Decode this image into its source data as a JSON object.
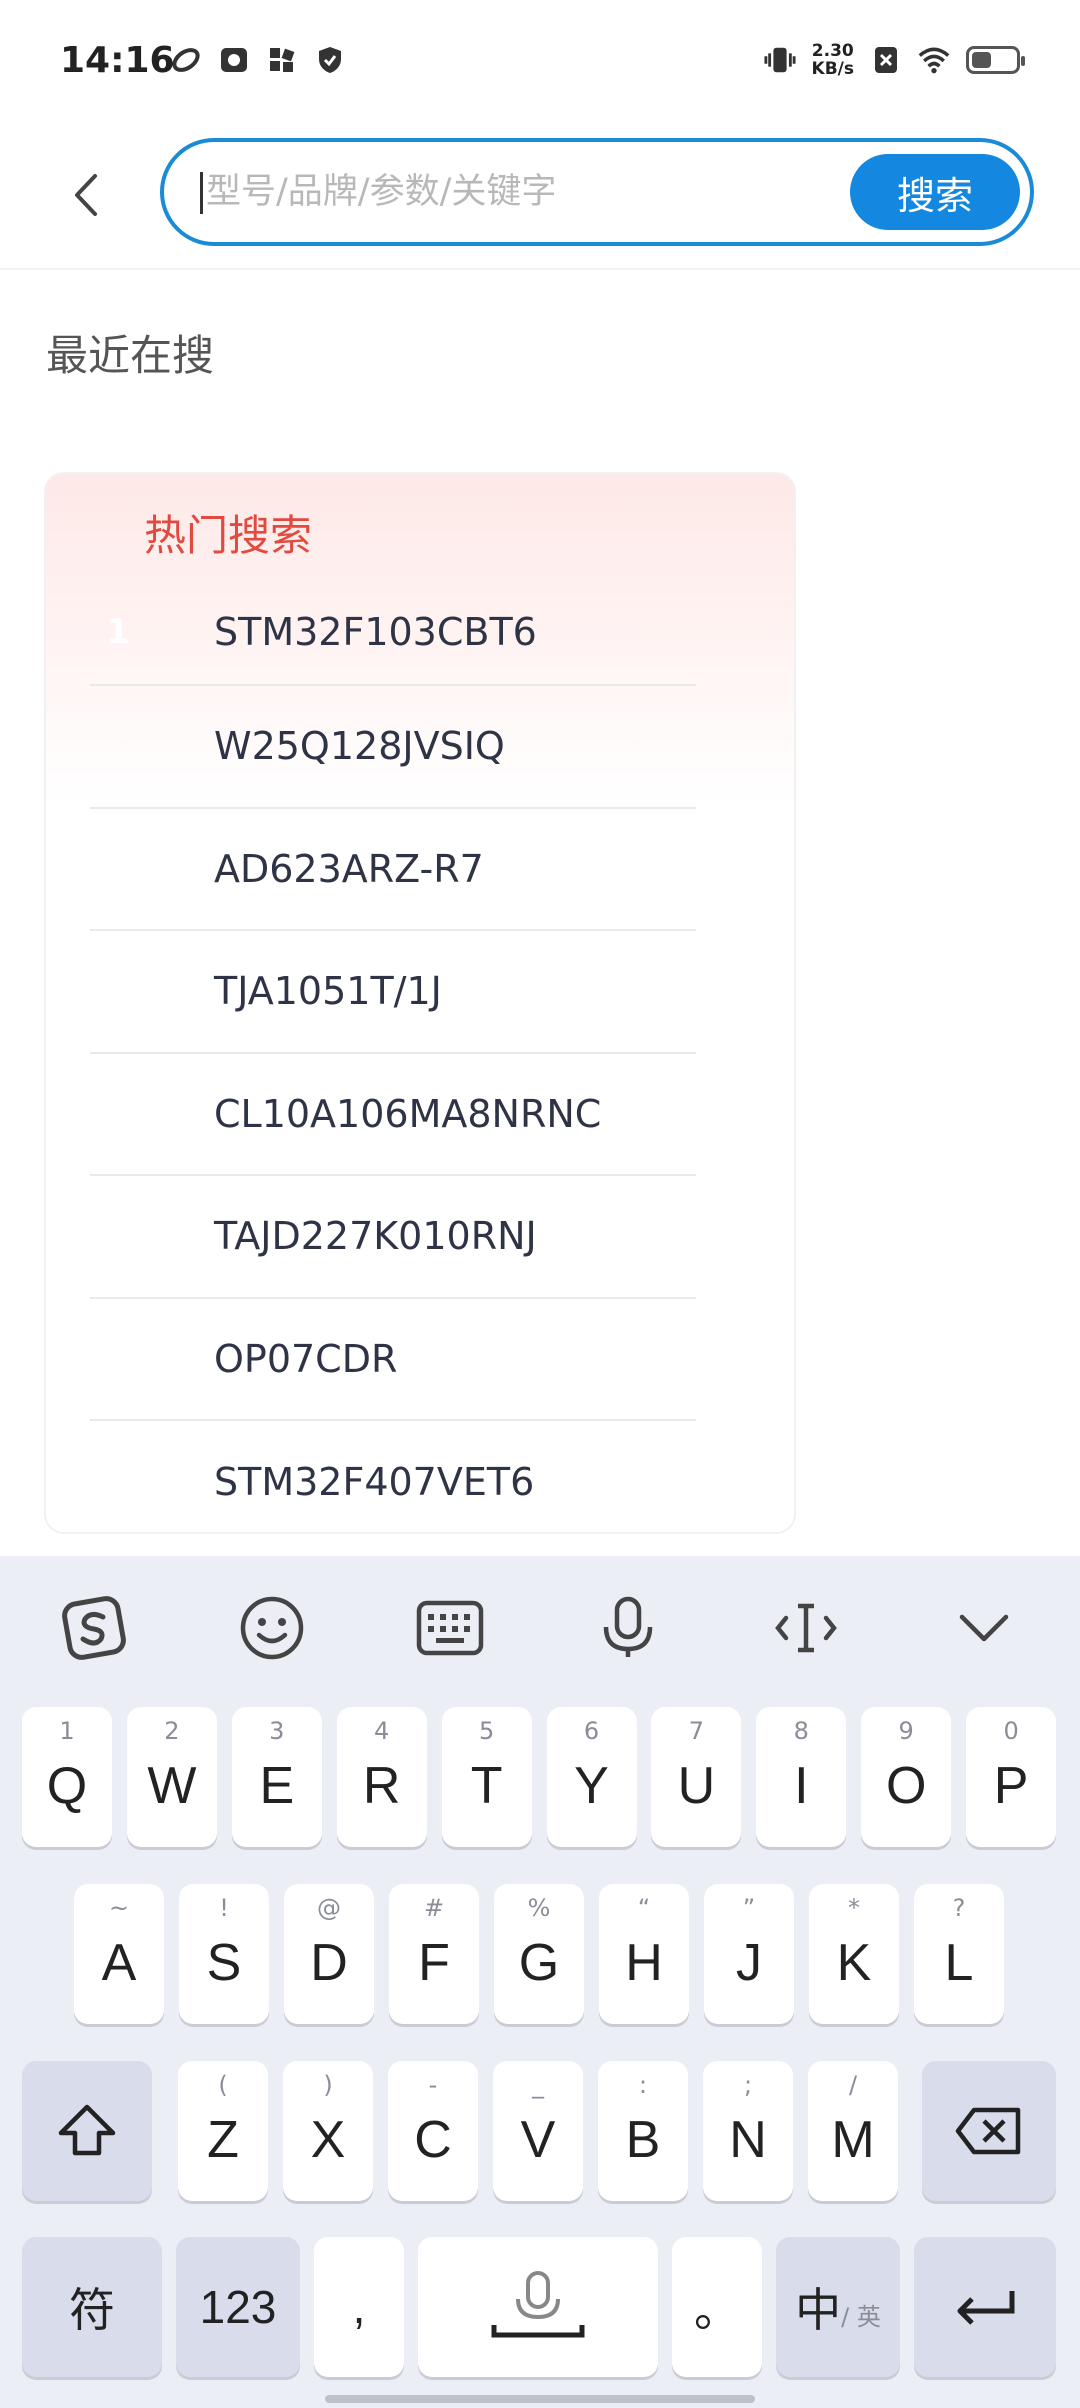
{
  "status_bar": {
    "time": "14:16",
    "net_speed_value": "2.30",
    "net_speed_unit": "KB/s"
  },
  "search": {
    "placeholder": "型号/品牌/参数/关键字",
    "value": "",
    "button_label": "搜索"
  },
  "recent": {
    "title": "最近在搜"
  },
  "hot": {
    "title": "热门搜索",
    "items": [
      {
        "rank": "1",
        "text": "STM32F103CBT6"
      },
      {
        "text": "W25Q128JVSIQ"
      },
      {
        "text": "AD623ARZ-R7"
      },
      {
        "text": "TJA1051T/1J"
      },
      {
        "text": "CL10A106MA8NRNC"
      },
      {
        "text": "TAJD227K010RNJ"
      },
      {
        "text": "OP07CDR"
      },
      {
        "text": "STM32F407VET6"
      }
    ]
  },
  "keyboard": {
    "row1": [
      {
        "k": "Q",
        "s": "1"
      },
      {
        "k": "W",
        "s": "2"
      },
      {
        "k": "E",
        "s": "3"
      },
      {
        "k": "R",
        "s": "4"
      },
      {
        "k": "T",
        "s": "5"
      },
      {
        "k": "Y",
        "s": "6"
      },
      {
        "k": "U",
        "s": "7"
      },
      {
        "k": "I",
        "s": "8"
      },
      {
        "k": "O",
        "s": "9"
      },
      {
        "k": "P",
        "s": "0"
      }
    ],
    "row2": [
      {
        "k": "A",
        "s": "~"
      },
      {
        "k": "S",
        "s": "!"
      },
      {
        "k": "D",
        "s": "@"
      },
      {
        "k": "F",
        "s": "#"
      },
      {
        "k": "G",
        "s": "%"
      },
      {
        "k": "H",
        "s": "“"
      },
      {
        "k": "J",
        "s": "”"
      },
      {
        "k": "K",
        "s": "*"
      },
      {
        "k": "L",
        "s": "?"
      }
    ],
    "row3": [
      {
        "k": "Z",
        "s": "("
      },
      {
        "k": "X",
        "s": ")"
      },
      {
        "k": "C",
        "s": "-"
      },
      {
        "k": "V",
        "s": "_"
      },
      {
        "k": "B",
        "s": ":"
      },
      {
        "k": "N",
        "s": ";"
      },
      {
        "k": "M",
        "s": "/"
      }
    ],
    "symbols_label": "符",
    "numbers_label": "123",
    "comma_label": ",",
    "period_label": "。",
    "lang_main": "中",
    "lang_sub": "/ 英"
  },
  "colors": {
    "accent": "#1487e0",
    "hot_title": "#e24a40",
    "keyboard_bg": "#eceef6"
  }
}
